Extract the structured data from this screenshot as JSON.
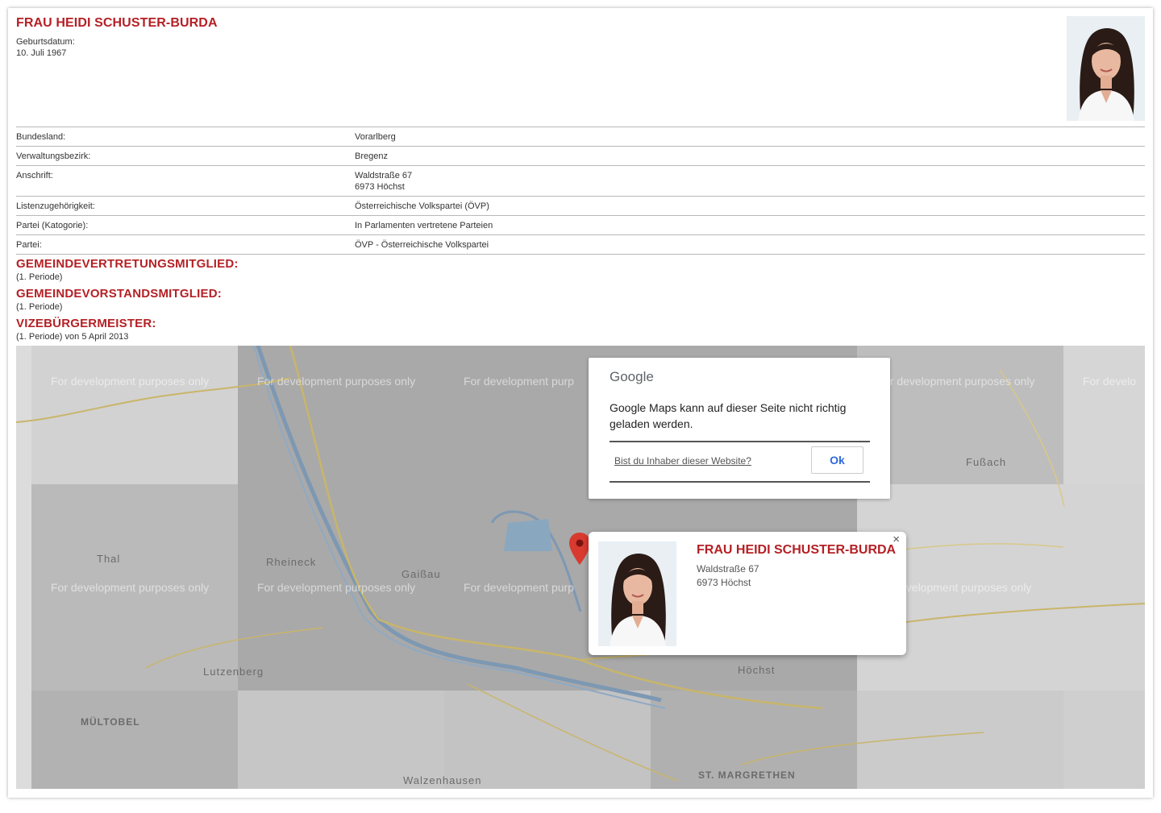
{
  "person": {
    "name": "FRAU HEIDI SCHUSTER-BURDA",
    "dob_label": "Geburtsdatum:",
    "dob_value": "10. Juli 1967"
  },
  "details": [
    {
      "label": "Bundesland:",
      "value": "Vorarlberg"
    },
    {
      "label": "Verwaltungsbezirk:",
      "value": "Bregenz"
    },
    {
      "label": "Anschrift:",
      "value": "Waldstraße 67",
      "value2": "6973 Höchst"
    },
    {
      "label": "Listenzugehörigkeit:",
      "value": "Österreichische Volkspartei (ÖVP)"
    },
    {
      "label": "Partei (Katogorie):",
      "value": "In Parlamenten vertretene Parteien"
    },
    {
      "label": "Partei:",
      "value": "ÖVP - Österreichische Volkspartei"
    }
  ],
  "sections": [
    {
      "title": "GEMEINDEVERTRETUNGSMITGLIED:",
      "sub": "(1. Periode)"
    },
    {
      "title": "GEMEINDEVORSTANDSMITGLIED:",
      "sub": "(1. Periode)"
    },
    {
      "title": "VIZEBÜRGERMEISTER:",
      "sub": "(1. Periode) von 5 April 2013"
    }
  ],
  "map": {
    "watermark": "For development purposes only",
    "watermark_partial_1": "For development purp",
    "watermark_partial_2": "For develo",
    "watermark_partial_3": "or development purposes only",
    "watermark_partial_4": "evelopment purposes only",
    "places": {
      "thal": "Thal",
      "rheineck": "Rheineck",
      "gaissau": "Gaißau",
      "lutzenberg": "Lutzenberg",
      "hoechst": "Höchst",
      "fussach": "Fußach",
      "multobel": "MÜLTOBEL",
      "walzenhausen": "Walzenhausen",
      "st_margrethen": "ST. MARGRETHEN"
    },
    "dialog": {
      "brand": "Google",
      "message": "Google Maps kann auf dieser Seite nicht richtig geladen werden.",
      "owner_link": "Bist du Inhaber dieser Website?",
      "ok_label": "Ok"
    },
    "info_window": {
      "name": "FRAU HEIDI SCHUSTER-BURDA",
      "street": "Waldstraße 67",
      "city": "6973 Höchst",
      "close": "×"
    }
  }
}
